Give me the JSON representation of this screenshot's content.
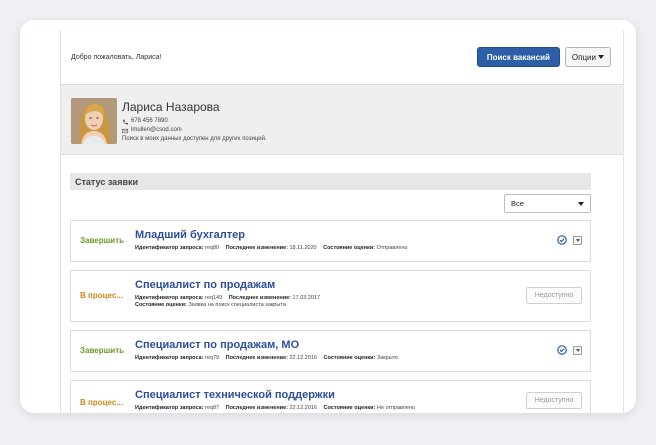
{
  "header": {
    "welcome": "Добро пожаловать, Лариса!",
    "search_button": "Поиск вакансий",
    "options_button": "Опции"
  },
  "profile": {
    "name": "Лариса Назарова",
    "phone": "678 456 7890",
    "email": "lmullen@csod.com",
    "privacy_note": "Поиск в моих данных доступен для других позиций."
  },
  "section": {
    "title": "Статус заявки",
    "filter_value": "Все"
  },
  "labels": {
    "request_id": "Идентификатор запроса:",
    "last_change": "Последнее изменение:",
    "assessment_status": "Состояние оценки:"
  },
  "requisitions": [
    {
      "status": "Завершить",
      "title": "Младший бухгалтер",
      "request_id": "req80",
      "last_change": "18.11.2020",
      "assessment_status": "Отправлено"
    },
    {
      "status": "В процес...",
      "title": "Специалист по продажам",
      "request_id": "req149",
      "last_change": "17.03.2017",
      "assessment_status": "Заявка на поиск специалиста закрыта",
      "action": "Недоступно"
    },
    {
      "status": "Завершить",
      "title": "Специалист по продажам, МО",
      "request_id": "req79",
      "last_change": "22.12.2016",
      "assessment_status": "Закрыто"
    },
    {
      "status": "В процес...",
      "title": "Специалист технической поддержки",
      "request_id": "req87",
      "last_change": "22.12.2016",
      "assessment_status": "Не отправлено",
      "action": "Недоступно"
    }
  ],
  "colors": {
    "primary": "#2d5fa8",
    "title_link": "#2d4e9c",
    "status_done": "#6a9a2a",
    "status_progress": "#c9891b"
  },
  "icons": {
    "phone": "phone-icon",
    "email": "envelope-icon",
    "check": "check-circle-icon",
    "dropdown": "chevron-down-icon"
  }
}
